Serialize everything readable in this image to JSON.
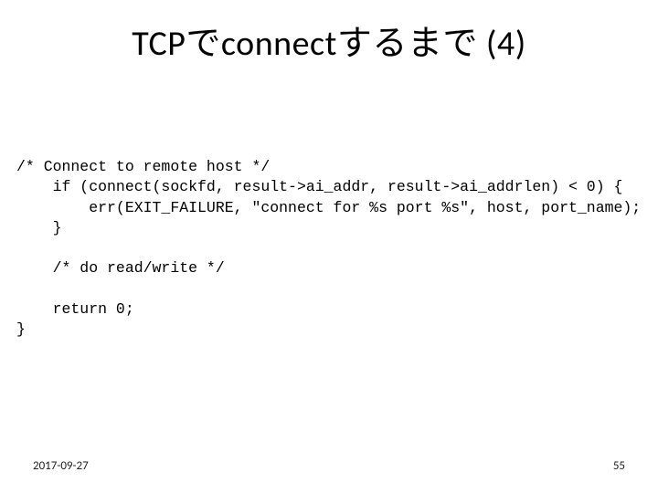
{
  "title": "TCPでconnectするまで (4)",
  "code": {
    "l1": "/* Connect to remote host */",
    "l2": "    if (connect(sockfd, result->ai_addr, result->ai_addrlen) < 0) {",
    "l3": "        err(EXIT_FAILURE, \"connect for %s port %s\", host, port_name);",
    "l4": "    }",
    "l5": "",
    "l6": "    /* do read/write */",
    "l7": "",
    "l8": "    return 0;",
    "l9": "}"
  },
  "footer": {
    "date": "2017-09-27",
    "page": "55"
  }
}
